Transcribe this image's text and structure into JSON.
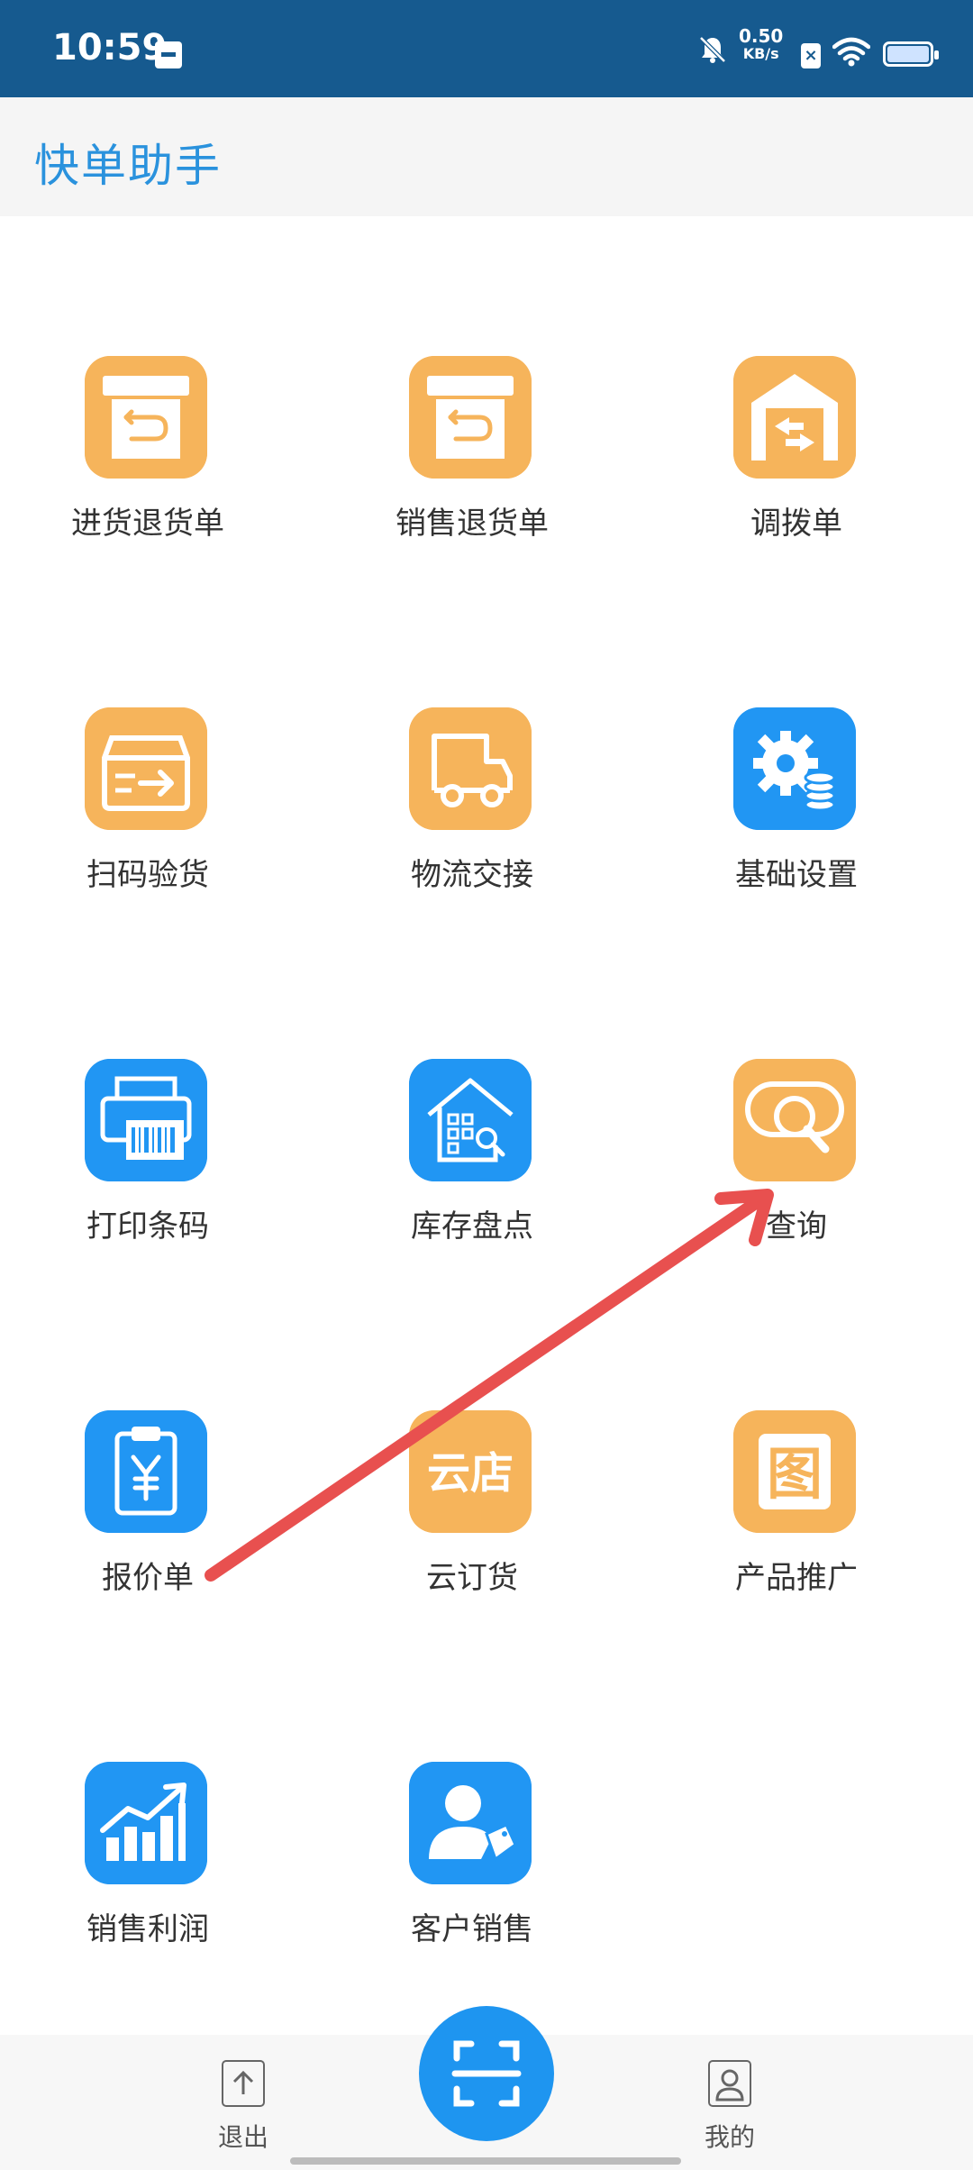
{
  "status_bar": {
    "time": "10:59",
    "net_speed_value": "0.50",
    "net_speed_unit": "KB/s"
  },
  "header": {
    "title": "快单助手"
  },
  "tiles": [
    {
      "label": "进货退货单",
      "icon": "return-box-icon",
      "color": "orange"
    },
    {
      "label": "销售退货单",
      "icon": "return-box-icon",
      "color": "orange"
    },
    {
      "label": "调拨单",
      "icon": "warehouse-transfer-icon",
      "color": "orange"
    },
    {
      "label": "扫码验货",
      "icon": "box-arrow-icon",
      "color": "orange"
    },
    {
      "label": "物流交接",
      "icon": "truck-icon",
      "color": "orange"
    },
    {
      "label": "基础设置",
      "icon": "gear-coins-icon",
      "color": "blue"
    },
    {
      "label": "打印条码",
      "icon": "barcode-printer-icon",
      "color": "blue"
    },
    {
      "label": "库存盘点",
      "icon": "house-search-icon",
      "color": "blue"
    },
    {
      "label": "查询",
      "icon": "search-icon",
      "color": "orange"
    },
    {
      "label": "报价单",
      "icon": "clipboard-yen-icon",
      "color": "blue"
    },
    {
      "label": "云订货",
      "icon": "cloud-store-icon",
      "color": "orange",
      "icon_text": "云店"
    },
    {
      "label": "产品推广",
      "icon": "image-frame-icon",
      "color": "orange",
      "icon_text": "图"
    },
    {
      "label": "销售利润",
      "icon": "growth-chart-icon",
      "color": "blue"
    },
    {
      "label": "客户销售",
      "icon": "customer-tag-icon",
      "color": "blue"
    }
  ],
  "bottom_bar": {
    "exit_label": "退出",
    "mine_label": "我的"
  },
  "colors": {
    "status_bar": "#165a8f",
    "title": "#2a92dd",
    "orange_tile": "#f6b45b",
    "blue_tile": "#2196f3",
    "annotation_arrow": "#e8504f"
  }
}
